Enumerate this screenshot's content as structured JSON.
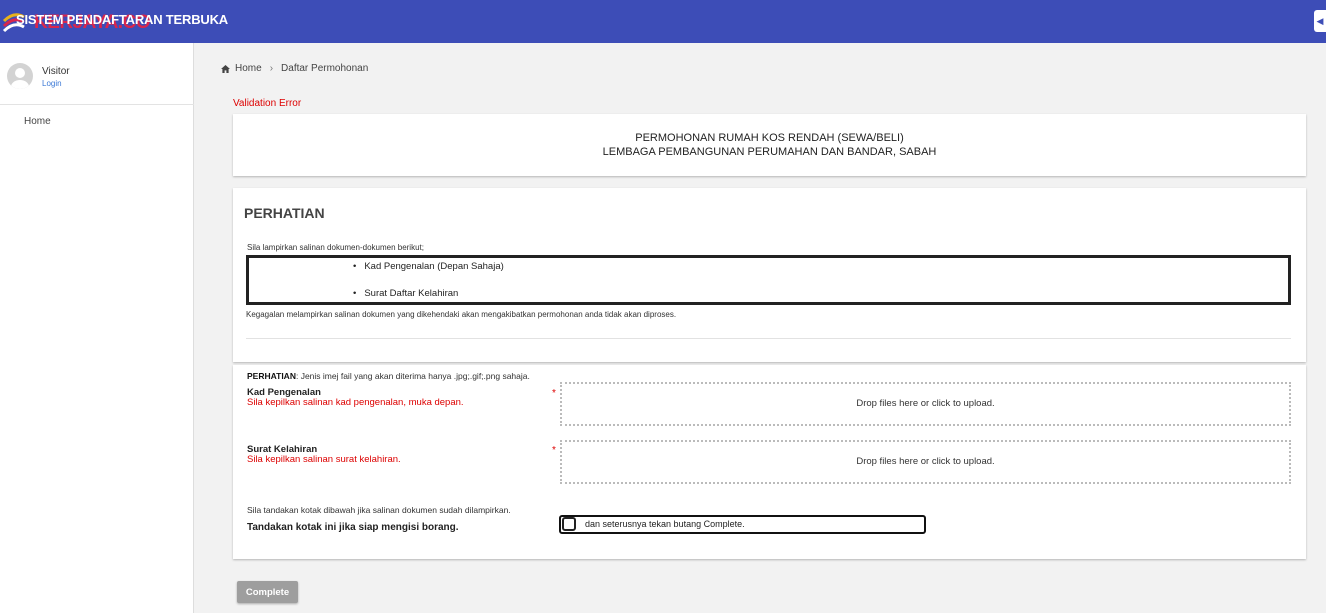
{
  "header": {
    "app_title": "SISTEM PENDAFTARAN TERBUKA",
    "brand_watermark": "KERJAYA.CO"
  },
  "sidebar": {
    "user_name": "Visitor",
    "login_link": "Login",
    "items": [
      {
        "label": "Home"
      }
    ]
  },
  "breadcrumb": {
    "home": "Home",
    "separator": "›",
    "current": "Daftar Permohonan"
  },
  "validation_error": "Validation Error",
  "form_title": {
    "line1": "PERMOHONAN RUMAH KOS RENDAH (SEWA/BELI)",
    "line2": "LEMBAGA PEMBANGUNAN PERUMAHAN DAN BANDAR, SABAH"
  },
  "perhatian": {
    "heading": "PERHATIAN",
    "intro": "Sila lampirkan salinan dokumen-dokumen berikut;",
    "documents": [
      "Kad Pengenalan (Depan Sahaja)",
      "Surat Daftar Kelahiran"
    ],
    "warning": "Kegagalan melampirkan salinan dokumen yang dikehendaki akan mengakibatkan permohonan anda tidak akan diproses."
  },
  "upload": {
    "note_bold": "PERHATIAN",
    "note_text": ": Jenis imej fail yang akan diterima hanya .jpg;.gif;.png sahaja.",
    "fields": [
      {
        "label": "Kad Pengenalan",
        "help": "Sila kepilkan salinan kad pengenalan, muka depan.",
        "required_mark": "*",
        "dropzone_text": "Drop files here or click to upload."
      },
      {
        "label": "Surat Kelahiran",
        "help": "Sila kepilkan salinan surat kelahiran.",
        "required_mark": "*",
        "dropzone_text": "Drop files here or click to upload."
      }
    ],
    "confirm_note": "Sila tandakan kotak dibawah jika salinan dokumen sudah dilampirkan.",
    "confirm_label": "Tandakan kotak ini jika siap mengisi borang.",
    "confirm_text": "dan seterusnya tekan butang Complete."
  },
  "complete_button": "Complete",
  "colors": {
    "header_bg": "#3d4db7",
    "error_red": "#dd0000",
    "button_grey": "#9e9e9e",
    "link_blue": "#3a78d6"
  }
}
